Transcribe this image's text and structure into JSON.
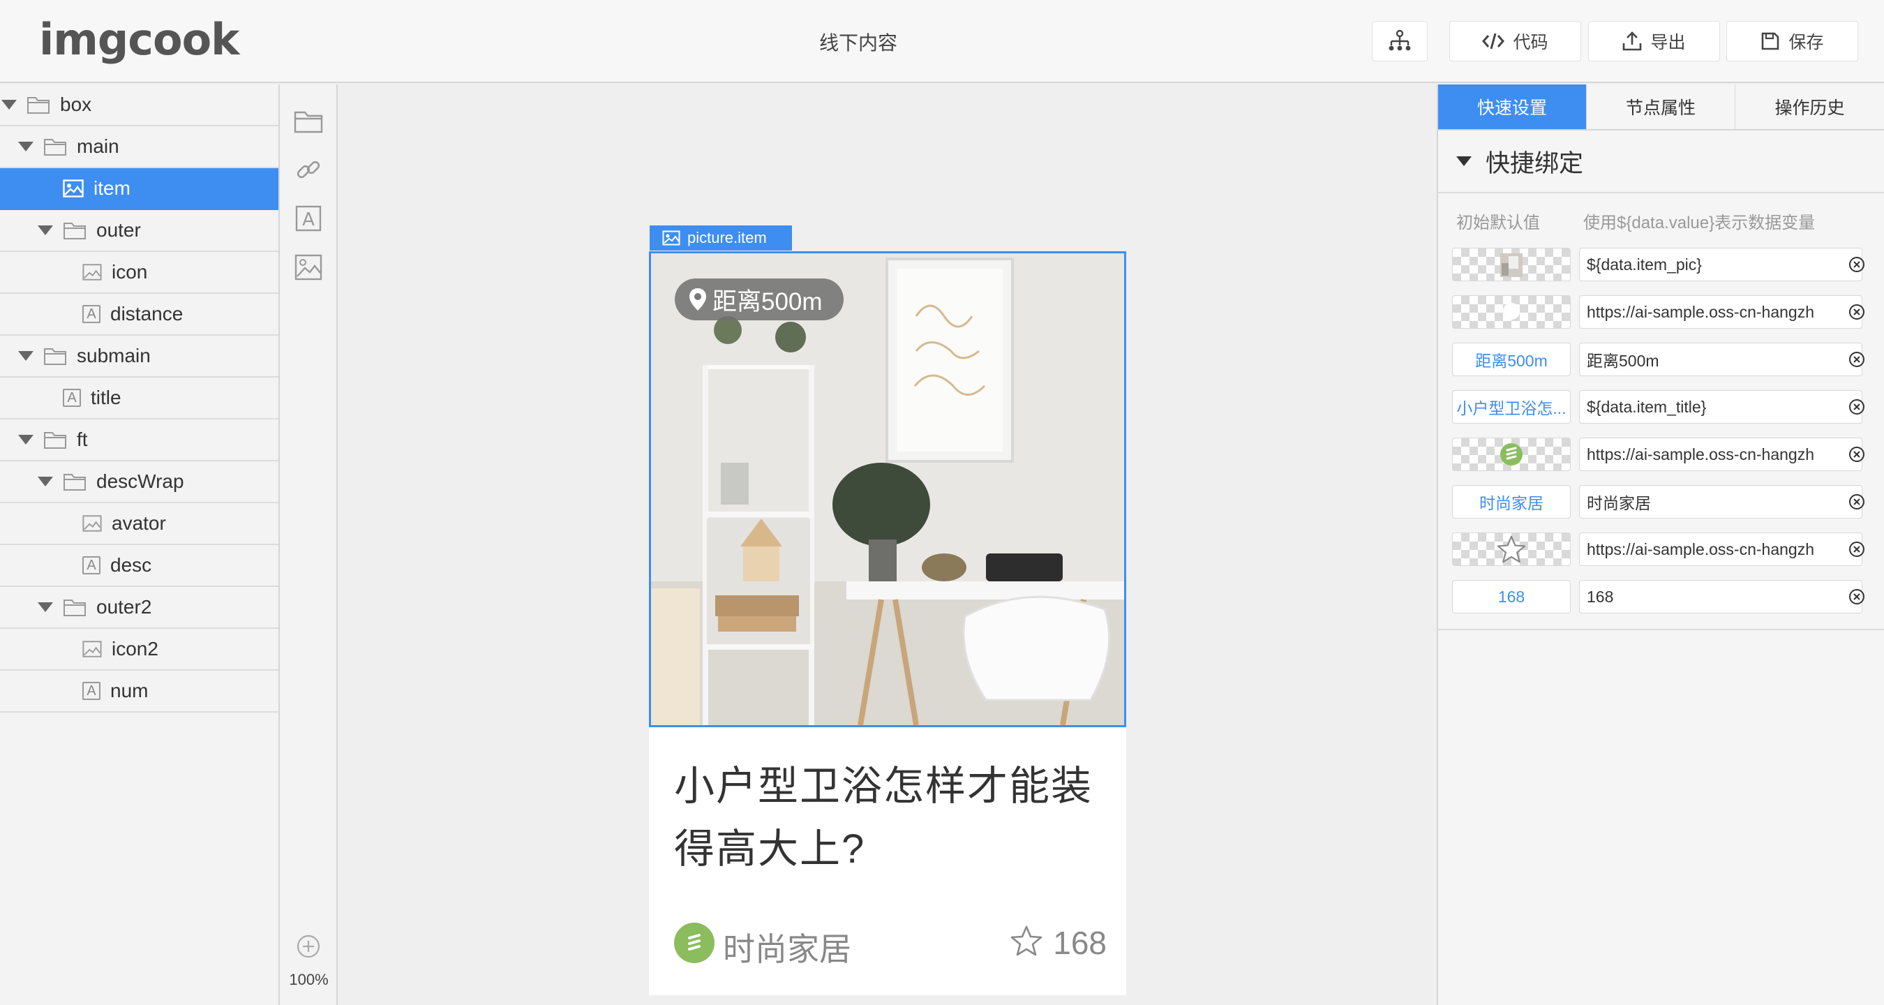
{
  "app": {
    "logo": "imgcook",
    "title": "线下内容"
  },
  "toolbar": {
    "code_label": "代码",
    "export_label": "导出",
    "save_label": "保存"
  },
  "tree": [
    {
      "label": "box",
      "type": "folder"
    },
    {
      "label": "main",
      "type": "folder"
    },
    {
      "label": "item",
      "type": "image"
    },
    {
      "label": "outer",
      "type": "folder"
    },
    {
      "label": "icon",
      "type": "image"
    },
    {
      "label": "distance",
      "type": "text"
    },
    {
      "label": "submain",
      "type": "folder"
    },
    {
      "label": "title",
      "type": "text"
    },
    {
      "label": "ft",
      "type": "folder"
    },
    {
      "label": "descWrap",
      "type": "folder"
    },
    {
      "label": "avator",
      "type": "image"
    },
    {
      "label": "desc",
      "type": "text"
    },
    {
      "label": "outer2",
      "type": "folder"
    },
    {
      "label": "icon2",
      "type": "image"
    },
    {
      "label": "num",
      "type": "text"
    }
  ],
  "tools": {
    "zoom": "100%"
  },
  "canvas": {
    "selection_label": "picture.item",
    "distance": "距离500m",
    "title": "小户型卫浴怎样才能装得高大上?",
    "desc": "时尚家居",
    "num": "168"
  },
  "panel": {
    "tabs": [
      "快速设置",
      "节点属性",
      "操作历史"
    ],
    "section_title": "快捷绑定",
    "col_default": "初始默认值",
    "col_hint": "使用${data.value}表示数据变量",
    "bindings": [
      {
        "default": "",
        "value": "${data.item_pic}"
      },
      {
        "default": "",
        "value": "https://ai-sample.oss-cn-hangzh"
      },
      {
        "default": "距离500m",
        "value": "距离500m"
      },
      {
        "default": "小户型卫浴怎...",
        "value": "${data.item_title}"
      },
      {
        "default": "",
        "value": "https://ai-sample.oss-cn-hangzh"
      },
      {
        "default": "时尚家居",
        "value": "时尚家居"
      },
      {
        "default": "",
        "value": "https://ai-sample.oss-cn-hangzh"
      },
      {
        "default": "168",
        "value": "168"
      }
    ]
  },
  "colors": {
    "accent": "#3d8ef0",
    "avatar": "#8bbd5d"
  }
}
